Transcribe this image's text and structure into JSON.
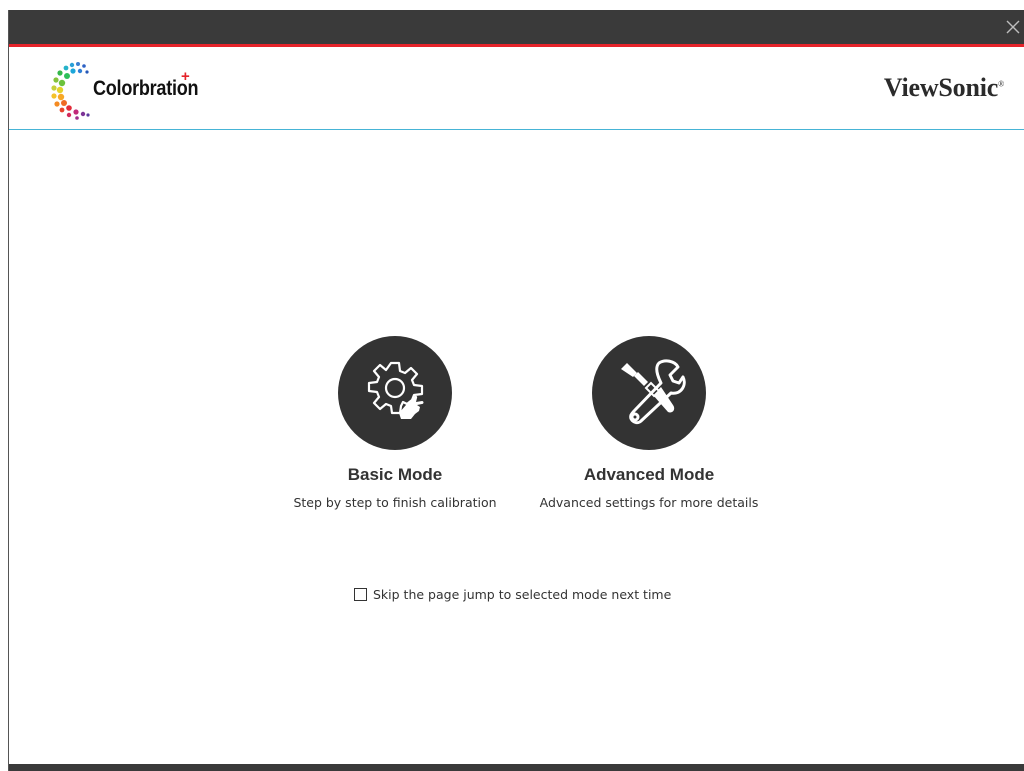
{
  "window": {
    "close_icon": "close-icon"
  },
  "header": {
    "logo_text": "Colorbration",
    "logo_plus": "+",
    "brand": "ViewSonic",
    "brand_mark": "®",
    "accent_color": "#e5232a",
    "divider_color": "#46b4d6"
  },
  "modes": [
    {
      "title": "Basic Mode",
      "description": "Step by step to finish calibration",
      "icon": "gear-hand-icon"
    },
    {
      "title": "Advanced Mode",
      "description": "Advanced settings for more details",
      "icon": "wrench-screwdriver-icon"
    }
  ],
  "skip": {
    "checked": false,
    "label": "Skip the page jump to selected mode next time"
  }
}
